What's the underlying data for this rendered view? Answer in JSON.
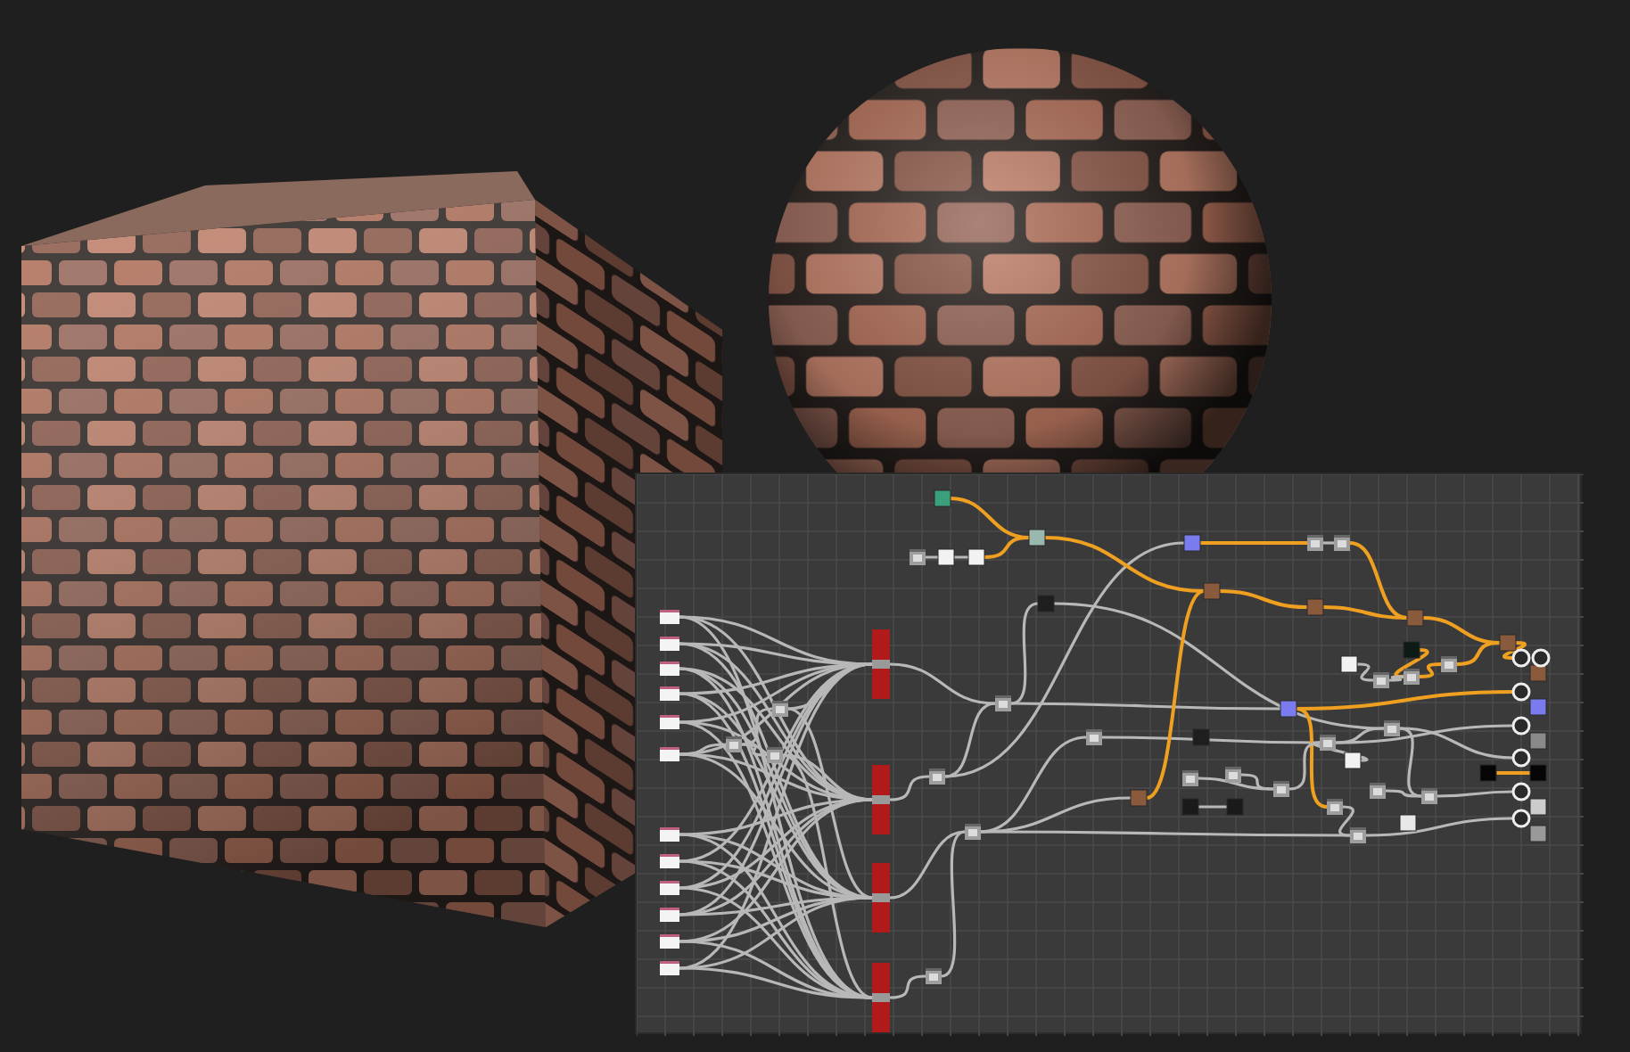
{
  "preview": {
    "objects": [
      {
        "kind": "cube"
      },
      {
        "kind": "sphere"
      }
    ]
  },
  "graph": {
    "nodes": [
      {
        "kind": "input"
      },
      {
        "kind": "input"
      },
      {
        "kind": "input"
      },
      {
        "kind": "input"
      },
      {
        "kind": "input"
      },
      {
        "kind": "input"
      },
      {
        "kind": "input"
      },
      {
        "kind": "input"
      },
      {
        "kind": "input"
      },
      {
        "kind": "input"
      },
      {
        "kind": "input"
      },
      {
        "kind": "input"
      },
      {
        "kind": "mask"
      },
      {
        "kind": "mask"
      },
      {
        "kind": "mask"
      },
      {
        "kind": "mask"
      },
      {
        "kind": "filter"
      },
      {
        "kind": "filter"
      },
      {
        "kind": "filter"
      },
      {
        "kind": "filter"
      },
      {
        "kind": "filter"
      },
      {
        "kind": "filter"
      },
      {
        "kind": "filter"
      },
      {
        "kind": "filter"
      },
      {
        "kind": "filter"
      },
      {
        "kind": "filter"
      },
      {
        "kind": "filter"
      },
      {
        "kind": "filter"
      },
      {
        "kind": "filter"
      },
      {
        "kind": "filter"
      },
      {
        "kind": "filter"
      },
      {
        "kind": "filter"
      },
      {
        "kind": "filter"
      },
      {
        "kind": "filter"
      },
      {
        "kind": "filter"
      },
      {
        "kind": "filter"
      },
      {
        "kind": "filter"
      },
      {
        "kind": "filter"
      },
      {
        "kind": "filter"
      },
      {
        "kind": "color",
        "color": "#1e1e1e"
      },
      {
        "kind": "color",
        "color": "#1e1e1e"
      },
      {
        "kind": "color",
        "color": "#1a1a1a"
      },
      {
        "kind": "color",
        "color": "#1a1a1a"
      },
      {
        "kind": "color",
        "color": "#3aa07c"
      },
      {
        "kind": "color",
        "color": "#f2f2f2"
      },
      {
        "kind": "color",
        "color": "#f2f2f2"
      },
      {
        "kind": "color",
        "color": "#9ab8ae"
      },
      {
        "kind": "color",
        "color": "#7b7bf0"
      },
      {
        "kind": "color",
        "color": "#7b7bf0"
      },
      {
        "kind": "color",
        "color": "#8a5a3c"
      },
      {
        "kind": "color",
        "color": "#8a5a3c"
      },
      {
        "kind": "color",
        "color": "#8a5a3c"
      },
      {
        "kind": "color",
        "color": "#8a5a3c"
      },
      {
        "kind": "color",
        "color": "#8a5a3c"
      },
      {
        "kind": "color",
        "color": "#0e1a14"
      },
      {
        "kind": "color",
        "color": "#f2f2f2"
      },
      {
        "kind": "color",
        "color": "#f2f2f2"
      },
      {
        "kind": "color",
        "color": "#050505"
      },
      {
        "kind": "color",
        "color": "#e8e8e8"
      },
      {
        "kind": "color",
        "color": "#8a5a3c"
      },
      {
        "kind": "color",
        "color": "#7b7bf0"
      },
      {
        "kind": "color",
        "color": "#8a8a8a"
      },
      {
        "kind": "color",
        "color": "#050505"
      },
      {
        "kind": "color",
        "color": "#cccccc"
      },
      {
        "kind": "color",
        "color": "#999999"
      },
      {
        "kind": "output"
      },
      {
        "kind": "output"
      },
      {
        "kind": "output"
      },
      {
        "kind": "output"
      },
      {
        "kind": "output"
      },
      {
        "kind": "output"
      },
      {
        "kind": "output"
      }
    ]
  }
}
